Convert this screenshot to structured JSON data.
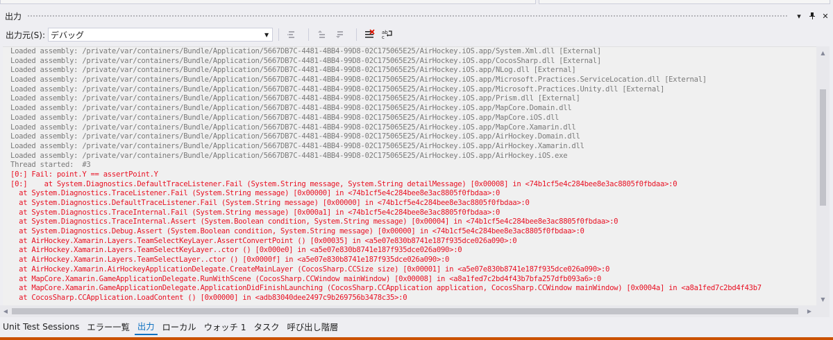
{
  "window": {
    "title": "出力",
    "buttons": {
      "menu": "▾",
      "pin": "⊥",
      "close": "✕"
    }
  },
  "toolbar": {
    "source_label": "出力元(S):",
    "source_value": "デバッグ",
    "icons": [
      "find-in-output-icon",
      "go-to-previous-message-icon",
      "go-to-next-message-icon",
      "clear-all-icon",
      "toggle-word-wrap-icon"
    ]
  },
  "output": {
    "lines": [
      {
        "text": "Loaded assembly: /private/var/containers/Bundle/Application/5667DB7C-4481-4BB4-99D8-02C175065E25/AirHockey.iOS.app/System.Xml.dll [External]",
        "error": false
      },
      {
        "text": "Loaded assembly: /private/var/containers/Bundle/Application/5667DB7C-4481-4BB4-99D8-02C175065E25/AirHockey.iOS.app/CocosSharp.dll [External]",
        "error": false
      },
      {
        "text": "Loaded assembly: /private/var/containers/Bundle/Application/5667DB7C-4481-4BB4-99D8-02C175065E25/AirHockey.iOS.app/NLog.dll [External]",
        "error": false
      },
      {
        "text": "Loaded assembly: /private/var/containers/Bundle/Application/5667DB7C-4481-4BB4-99D8-02C175065E25/AirHockey.iOS.app/Microsoft.Practices.ServiceLocation.dll [External]",
        "error": false
      },
      {
        "text": "Loaded assembly: /private/var/containers/Bundle/Application/5667DB7C-4481-4BB4-99D8-02C175065E25/AirHockey.iOS.app/Microsoft.Practices.Unity.dll [External]",
        "error": false
      },
      {
        "text": "Loaded assembly: /private/var/containers/Bundle/Application/5667DB7C-4481-4BB4-99D8-02C175065E25/AirHockey.iOS.app/Prism.dll [External]",
        "error": false
      },
      {
        "text": "Loaded assembly: /private/var/containers/Bundle/Application/5667DB7C-4481-4BB4-99D8-02C175065E25/AirHockey.iOS.app/MapCore.Domain.dll",
        "error": false
      },
      {
        "text": "Loaded assembly: /private/var/containers/Bundle/Application/5667DB7C-4481-4BB4-99D8-02C175065E25/AirHockey.iOS.app/MapCore.iOS.dll",
        "error": false
      },
      {
        "text": "Loaded assembly: /private/var/containers/Bundle/Application/5667DB7C-4481-4BB4-99D8-02C175065E25/AirHockey.iOS.app/MapCore.Xamarin.dll",
        "error": false
      },
      {
        "text": "Loaded assembly: /private/var/containers/Bundle/Application/5667DB7C-4481-4BB4-99D8-02C175065E25/AirHockey.iOS.app/AirHockey.Domain.dll",
        "error": false
      },
      {
        "text": "Loaded assembly: /private/var/containers/Bundle/Application/5667DB7C-4481-4BB4-99D8-02C175065E25/AirHockey.iOS.app/AirHockey.Xamarin.dll",
        "error": false
      },
      {
        "text": "Loaded assembly: /private/var/containers/Bundle/Application/5667DB7C-4481-4BB4-99D8-02C175065E25/AirHockey.iOS.app/AirHockey.iOS.exe",
        "error": false
      },
      {
        "text": "Thread started:  #3",
        "error": false
      },
      {
        "text": "[0:] Fail: point.Y == assertPoint.Y",
        "error": true
      },
      {
        "text": "[0:]    at System.Diagnostics.DefaultTraceListener.Fail (System.String message, System.String detailMessage) [0x00008] in <74b1cf5e4c284bee8e3ac8805f0fbdaa>:0",
        "error": true
      },
      {
        "text": "  at System.Diagnostics.TraceListener.Fail (System.String message) [0x00000] in <74b1cf5e4c284bee8e3ac8805f0fbdaa>:0",
        "error": true
      },
      {
        "text": "  at System.Diagnostics.DefaultTraceListener.Fail (System.String message) [0x00000] in <74b1cf5e4c284bee8e3ac8805f0fbdaa>:0",
        "error": true
      },
      {
        "text": "  at System.Diagnostics.TraceInternal.Fail (System.String message) [0x000a1] in <74b1cf5e4c284bee8e3ac8805f0fbdaa>:0",
        "error": true
      },
      {
        "text": "  at System.Diagnostics.TraceInternal.Assert (System.Boolean condition, System.String message) [0x00004] in <74b1cf5e4c284bee8e3ac8805f0fbdaa>:0",
        "error": true
      },
      {
        "text": "  at System.Diagnostics.Debug.Assert (System.Boolean condition, System.String message) [0x00000] in <74b1cf5e4c284bee8e3ac8805f0fbdaa>:0",
        "error": true
      },
      {
        "text": "  at AirHockey.Xamarin.Layers.TeamSelectKeyLayer.AssertConvertPoint () [0x00035] in <a5e07e830b8741e187f935dce026a090>:0",
        "error": true
      },
      {
        "text": "  at AirHockey.Xamarin.Layers.TeamSelectKeyLayer..ctor () [0x000e0] in <a5e07e830b8741e187f935dce026a090>:0",
        "error": true
      },
      {
        "text": "  at AirHockey.Xamarin.Layers.TeamSelectLayer..ctor () [0x0000f] in <a5e07e830b8741e187f935dce026a090>:0",
        "error": true
      },
      {
        "text": "  at AirHockey.Xamarin.AirHockeyApplicationDelegate.CreateMainLayer (CocosSharp.CCSize size) [0x00001] in <a5e07e830b8741e187f935dce026a090>:0",
        "error": true
      },
      {
        "text": "  at MapCore.Xamarin.GameApplicationDelegate.RunWithScene (CocosSharp.CCWindow mainWindow) [0x00008] in <a8a1fed7c2bd4f43b7bfa257dfb093a6>:0",
        "error": true
      },
      {
        "text": "  at MapCore.Xamarin.GameApplicationDelegate.ApplicationDidFinishLaunching (CocosSharp.CCApplication application, CocosSharp.CCWindow mainWindow) [0x0004a] in <a8a1fed7c2bd4f43b7",
        "error": true
      },
      {
        "text": "  at CocosSharp.CCApplication.LoadContent () [0x00000] in <adb83040dee2497c9b269756b3478c35>:0",
        "error": true
      }
    ]
  },
  "scrollbars": {
    "up": "▲",
    "down": "▼",
    "left": "◀",
    "right": "▶"
  },
  "tabs": [
    {
      "label": "Unit Test Sessions",
      "active": false
    },
    {
      "label": "エラー一覧",
      "active": false
    },
    {
      "label": "出力",
      "active": true
    },
    {
      "label": "ローカル",
      "active": false
    },
    {
      "label": "ウォッチ 1",
      "active": false
    },
    {
      "label": "タスク",
      "active": false
    },
    {
      "label": "呼び出し階層",
      "active": false
    }
  ],
  "colors": {
    "error_text": "#e81123",
    "info_text": "#7a7a7a",
    "accent": "#0e70c0",
    "status_bar": "#ca5100"
  }
}
